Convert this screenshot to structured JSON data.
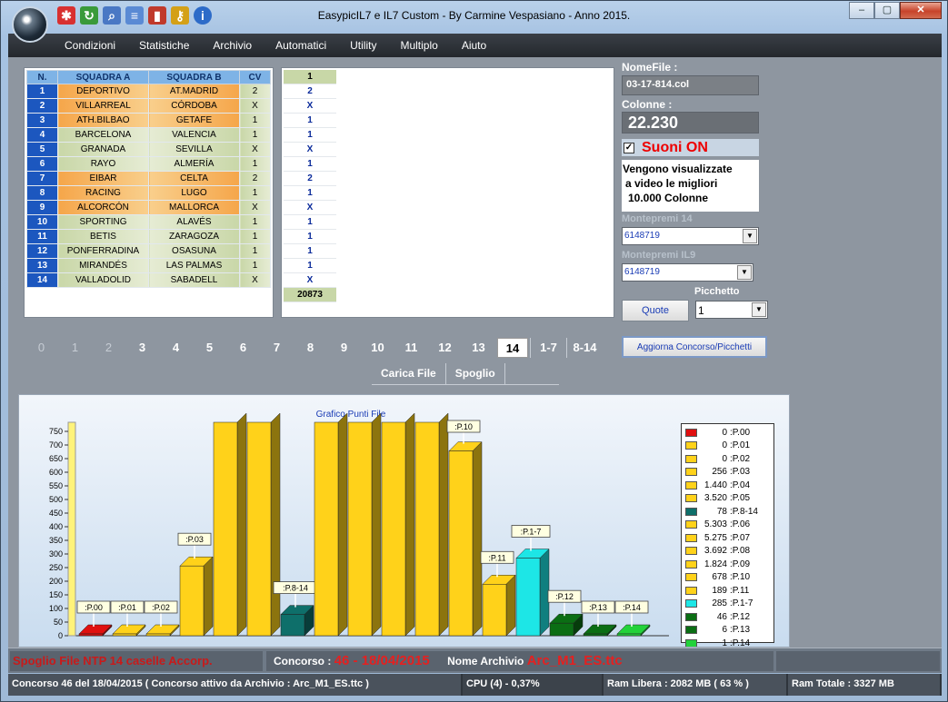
{
  "window": {
    "title": "EasypicIL7 e IL7 Custom - By Carmine Vespasiano - Anno 2015.",
    "controls": [
      "–",
      "▢",
      "✕"
    ]
  },
  "quick_icons": [
    "runner-icon",
    "refresh-icon",
    "search-doc-icon",
    "notes-icon",
    "chart-icon",
    "key-icon",
    "info-icon"
  ],
  "menu": [
    "Condizioni",
    "Statistiche",
    "Archivio",
    "Automatici",
    "Utility",
    "Multiplo",
    "Aiuto"
  ],
  "squadre_table": {
    "headers": [
      "N.",
      "SQUADRA A",
      "SQUADRA B",
      "CV"
    ],
    "rows": [
      [
        "1",
        "DEPORTIVO",
        "AT.MADRID",
        "2"
      ],
      [
        "2",
        "VILLARREAL",
        "CÓRDOBA",
        "X"
      ],
      [
        "3",
        "ATH.BILBAO",
        "GETAFE",
        "1"
      ],
      [
        "4",
        "BARCELONA",
        "VALENCIA",
        "1"
      ],
      [
        "5",
        "GRANADA",
        "SEVILLA",
        "X"
      ],
      [
        "6",
        "RAYO",
        "ALMERÍA",
        "1"
      ],
      [
        "7",
        "EIBAR",
        "CELTA",
        "2"
      ],
      [
        "8",
        "RACING",
        "LUGO",
        "1"
      ],
      [
        "9",
        "ALCORCÓN",
        "MALLORCA",
        "X"
      ],
      [
        "10",
        "SPORTING",
        "ALAVÉS",
        "1"
      ],
      [
        "11",
        "BETIS",
        "ZARAGOZA",
        "1"
      ],
      [
        "12",
        "PONFERRADINA",
        "OSASUNA",
        "1"
      ],
      [
        "13",
        "MIRANDÉS",
        "LAS PALMAS",
        "1"
      ],
      [
        "14",
        "VALLADOLID",
        "SABADELL",
        "X"
      ]
    ],
    "row_styles": [
      "or",
      "or",
      "or",
      "gr",
      "gr",
      "gr",
      "or",
      "or",
      "or",
      "gr",
      "gr",
      "gr",
      "gr",
      "gr"
    ]
  },
  "column_grid": {
    "header": "1",
    "values": [
      "2",
      "X",
      "1",
      "1",
      "X",
      "1",
      "2",
      "1",
      "X",
      "1",
      "1",
      "1",
      "1",
      "X"
    ],
    "footer": "20873"
  },
  "right_panel": {
    "nomefile_label": "NomeFile :",
    "nomefile_value": "03-17-814.col",
    "colonne_label": "Colonne :",
    "colonne_value": "22.230",
    "suoni_label": "Suoni ON",
    "suoni_checked": true,
    "info_text_1": "Vengono visualizzate",
    "info_text_2": "a video le migliori",
    "info_text_3": "10.000 Colonne",
    "montepremi14_label": "Montepremi 14",
    "montepremi14_value": "6148719",
    "montepremiIL9_label": "Montepremi IL9",
    "montepremiIL9_value": "6148719",
    "picchetto_label": "Picchetto",
    "picchetto_value": "1",
    "quote_button": "Quote",
    "aggiorna_button": "Aggiorna Concorso/Picchetti"
  },
  "number_tabs": {
    "items": [
      "0",
      "1",
      "2",
      "3",
      "4",
      "5",
      "6",
      "7",
      "8",
      "9",
      "10",
      "11",
      "12",
      "13",
      "14",
      "1-7",
      "8-14"
    ],
    "dim": [
      "0",
      "1",
      "2"
    ],
    "selected": "14"
  },
  "sub_tabs": [
    "Carica File",
    "Spoglio"
  ],
  "chart_data": {
    "type": "bar",
    "title": "Grafico Punti File",
    "categories": [
      ":P.00",
      ":P.01",
      ":P.02",
      ":P.03",
      ":P.04",
      ":P.05",
      ":P.8-14",
      ":P.06",
      ":P.07",
      ":P.08",
      ":P.09",
      ":P.10",
      ":P.11",
      ":P.1-7",
      ":P.12",
      ":P.13",
      ":P.14"
    ],
    "values": [
      0,
      0,
      0,
      256,
      1440,
      3520,
      78,
      5303,
      5275,
      3692,
      1824,
      678,
      189,
      285,
      46,
      6,
      1
    ],
    "colors": [
      "#e01010",
      "#ffd21a",
      "#ffd21a",
      "#ffd21a",
      "#ffd21a",
      "#ffd21a",
      "#0e6f6a",
      "#ffd21a",
      "#ffd21a",
      "#ffd21a",
      "#ffd21a",
      "#ffd21a",
      "#ffd21a",
      "#1de6e6",
      "#0b6e14",
      "#0b6e14",
      "#23d23a"
    ],
    "show_label": [
      true,
      true,
      true,
      true,
      false,
      false,
      true,
      false,
      false,
      false,
      false,
      true,
      true,
      true,
      true,
      true,
      true
    ],
    "yticks": [
      0,
      50,
      100,
      150,
      200,
      250,
      300,
      350,
      400,
      450,
      500,
      550,
      600,
      650,
      700,
      750
    ],
    "ylim": [
      0,
      800
    ],
    "legend": [
      {
        "value": "0",
        "label": ":P.00"
      },
      {
        "value": "0",
        "label": ":P.01"
      },
      {
        "value": "0",
        "label": ":P.02"
      },
      {
        "value": "256",
        "label": ":P.03"
      },
      {
        "value": "1.440",
        "label": ":P.04"
      },
      {
        "value": "3.520",
        "label": ":P.05"
      },
      {
        "value": "78",
        "label": ":P.8-14"
      },
      {
        "value": "5.303",
        "label": ":P.06"
      },
      {
        "value": "5.275",
        "label": ":P.07"
      },
      {
        "value": "3.692",
        "label": ":P.08"
      },
      {
        "value": "1.824",
        "label": ":P.09"
      },
      {
        "value": "678",
        "label": ":P.10"
      },
      {
        "value": "189",
        "label": ":P.11"
      },
      {
        "value": "285",
        "label": ":P.1-7"
      },
      {
        "value": "46",
        "label": ":P.12"
      },
      {
        "value": "6",
        "label": ":P.13"
      },
      {
        "value": "1",
        "label": ":P.14"
      }
    ]
  },
  "status_top": {
    "left": "Spoglio File NTP 14 caselle Accorp.",
    "concorso_label": "Concorso :",
    "concorso_value": "46 - 18/04/2015",
    "archivio_label": "Nome Archivio",
    "archivio_value": "Arc_M1_ES.ttc"
  },
  "status_bottom": [
    "Concorso 46 del 18/04/2015 ( Concorso attivo da Archivio : Arc_M1_ES.ttc )",
    "CPU (4) -  0,37%",
    "Ram Libera : 2082 MB ( 63 % )",
    "Ram Totale : 3327 MB"
  ]
}
